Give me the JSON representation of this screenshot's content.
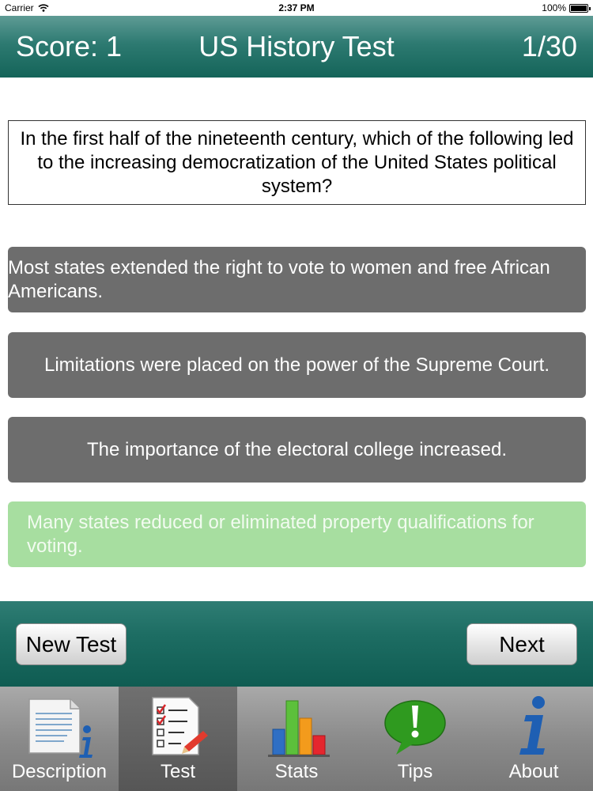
{
  "status_bar": {
    "carrier": "Carrier",
    "time": "2:37 PM",
    "battery": "100%"
  },
  "header": {
    "score": "Score: 1",
    "title": "US History Test",
    "progress": "1/30"
  },
  "question": "In the first half of the nineteenth century, which of the following led to the increasing democratization of the United States political system?",
  "answers": [
    {
      "text": "Most states extended the right to vote to women and free African Americans.",
      "state": "default"
    },
    {
      "text": "Limitations were placed on the power of the Supreme Court.",
      "state": "default"
    },
    {
      "text": "The importance of the electoral college increased.",
      "state": "default"
    },
    {
      "text": "Many states reduced or eliminated property qualifications for voting.",
      "state": "correct"
    }
  ],
  "buttons": {
    "new_test": "New Test",
    "next": "Next"
  },
  "tabs": [
    {
      "label": "Description",
      "icon": "description-icon",
      "active": false
    },
    {
      "label": "Test",
      "icon": "checklist-icon",
      "active": true
    },
    {
      "label": "Stats",
      "icon": "bar-chart-icon",
      "active": false
    },
    {
      "label": "Tips",
      "icon": "exclamation-bubble-icon",
      "active": false
    },
    {
      "label": "About",
      "icon": "info-icon",
      "active": false
    }
  ],
  "colors": {
    "header": "#2d7a71",
    "answer_default": "#6d6d6d",
    "answer_correct": "#a7dea0"
  }
}
